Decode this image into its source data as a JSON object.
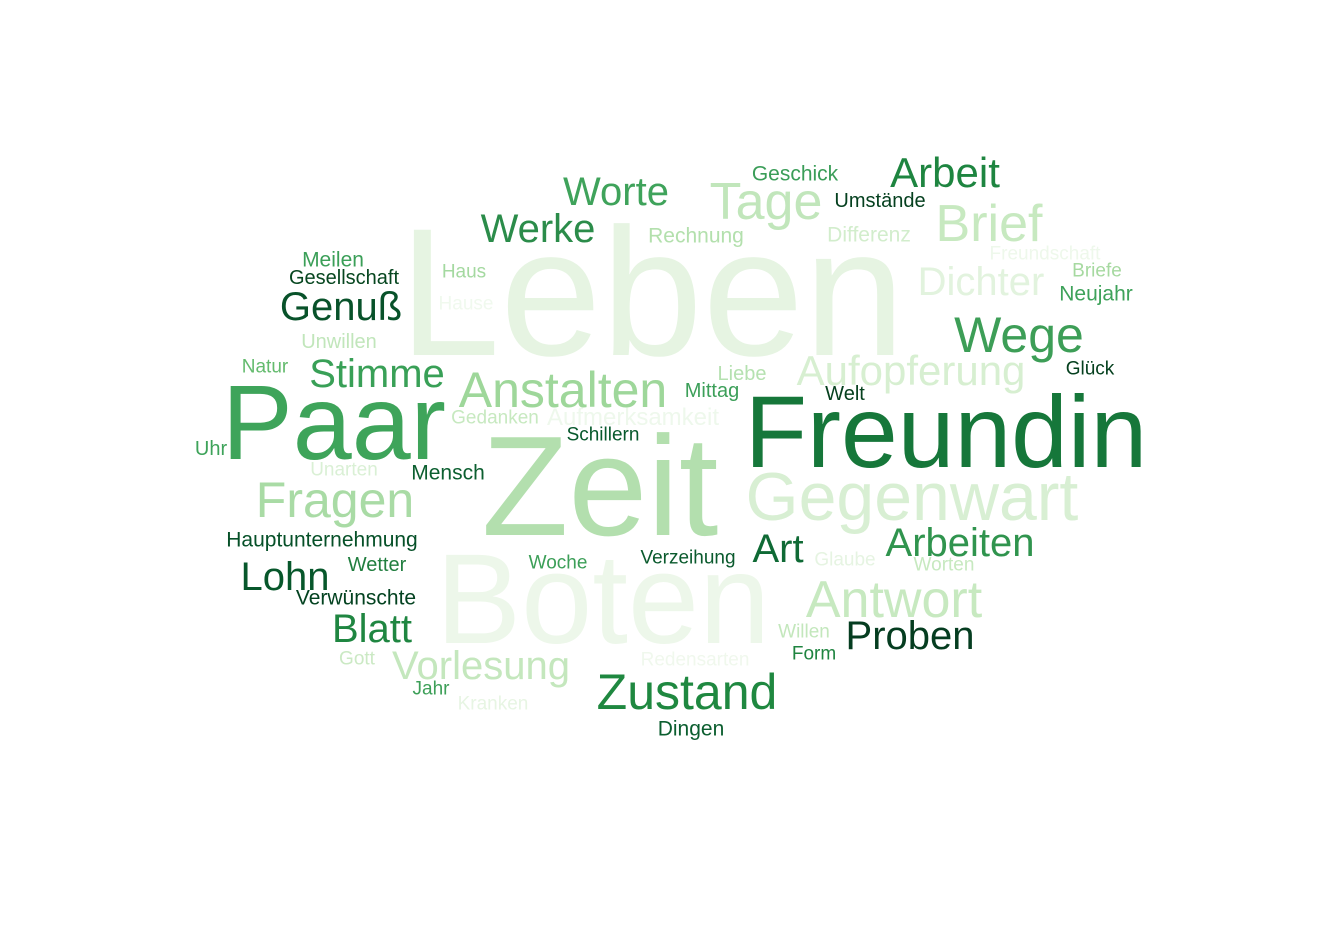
{
  "words": [
    {
      "text": "Leben",
      "color": "#e6f4e2"
    },
    {
      "text": "Boten",
      "color": "#edf7ea"
    },
    {
      "text": "Zeit",
      "color": "#b3dfae"
    },
    {
      "text": "Freundin",
      "color": "#16773a"
    },
    {
      "text": "Paar",
      "color": "#3ea45a"
    },
    {
      "text": "Gegenwart",
      "color": "#d8efd3"
    },
    {
      "text": "Fragen",
      "color": "#a9dba5"
    },
    {
      "text": "Anstalten",
      "color": "#9ed79a"
    },
    {
      "text": "Antwort",
      "color": "#c7e9c0"
    },
    {
      "text": "Zustand",
      "color": "#1f8840"
    },
    {
      "text": "Aufopferung",
      "color": "#d7efd1"
    },
    {
      "text": "Tage",
      "color": "#c1e6bb"
    },
    {
      "text": "Brief",
      "color": "#c7e9c0"
    },
    {
      "text": "Wege",
      "color": "#3d9e57"
    },
    {
      "text": "Arbeit",
      "color": "#1e8540"
    },
    {
      "text": "Worte",
      "color": "#3fa35b"
    },
    {
      "text": "Werke",
      "color": "#2b8c4a"
    },
    {
      "text": "Genuß",
      "color": "#08522a"
    },
    {
      "text": "Stimme",
      "color": "#39a057"
    },
    {
      "text": "Dichter",
      "color": "#e2f3de"
    },
    {
      "text": "Arbeiten",
      "color": "#30944e"
    },
    {
      "text": "Vorlesung",
      "color": "#c4e7bd"
    },
    {
      "text": "Blatt",
      "color": "#1f8641"
    },
    {
      "text": "Lohn",
      "color": "#07572b"
    },
    {
      "text": "Proben",
      "color": "#053d20"
    },
    {
      "text": "Art",
      "color": "#0f6a35"
    },
    {
      "text": "Aufmerksamkeit",
      "color": "#eef8ec"
    },
    {
      "text": "Hauptunternehmung",
      "color": "#065028"
    },
    {
      "text": "Verwünschte",
      "color": "#034220"
    },
    {
      "text": "Geschick",
      "color": "#3a9d58"
    },
    {
      "text": "Umstände",
      "color": "#05401f"
    },
    {
      "text": "Rechnung",
      "color": "#b3e0ad"
    },
    {
      "text": "Differenz",
      "color": "#d2edcc"
    },
    {
      "text": "Freundschaft",
      "color": "#eef8eb"
    },
    {
      "text": "Briefe",
      "color": "#a6d9a0"
    },
    {
      "text": "Neujahr",
      "color": "#3ea25a"
    },
    {
      "text": "Meilen",
      "color": "#3b9f58"
    },
    {
      "text": "Gesellschaft",
      "color": "#06461f"
    },
    {
      "text": "Haus",
      "color": "#a4d9a0"
    },
    {
      "text": "Hause",
      "color": "#f0f9ee"
    },
    {
      "text": "Unwillen",
      "color": "#c1e6bb"
    },
    {
      "text": "Natur",
      "color": "#64bb6e"
    },
    {
      "text": "Liebe",
      "color": "#b5e1b0"
    },
    {
      "text": "Mittag",
      "color": "#3c9f59"
    },
    {
      "text": "Welt",
      "color": "#06401e"
    },
    {
      "text": "Glück",
      "color": "#05401e"
    },
    {
      "text": "Gedanken",
      "color": "#c7e9c0"
    },
    {
      "text": "Schillern",
      "color": "#07592c"
    },
    {
      "text": "Uhr",
      "color": "#3ea35a"
    },
    {
      "text": "Unarten",
      "color": "#daf0d5"
    },
    {
      "text": "Mensch",
      "color": "#0c5f30"
    },
    {
      "text": "Woche",
      "color": "#3c9f58"
    },
    {
      "text": "Verzeihung",
      "color": "#0a5a2d"
    },
    {
      "text": "Glaube",
      "color": "#e6f4e2"
    },
    {
      "text": "Worten",
      "color": "#c7e9c0"
    },
    {
      "text": "Wetter",
      "color": "#217e3f"
    },
    {
      "text": "Willen",
      "color": "#c3e7bc"
    },
    {
      "text": "Form",
      "color": "#1f8440"
    },
    {
      "text": "Gott",
      "color": "#cbe9c4"
    },
    {
      "text": "Redensarten",
      "color": "#f0f8ed"
    },
    {
      "text": "Jahr",
      "color": "#3d9f58"
    },
    {
      "text": "Kranken",
      "color": "#e7f5e3"
    },
    {
      "text": "Dingen",
      "color": "#0b5e2f"
    }
  ]
}
